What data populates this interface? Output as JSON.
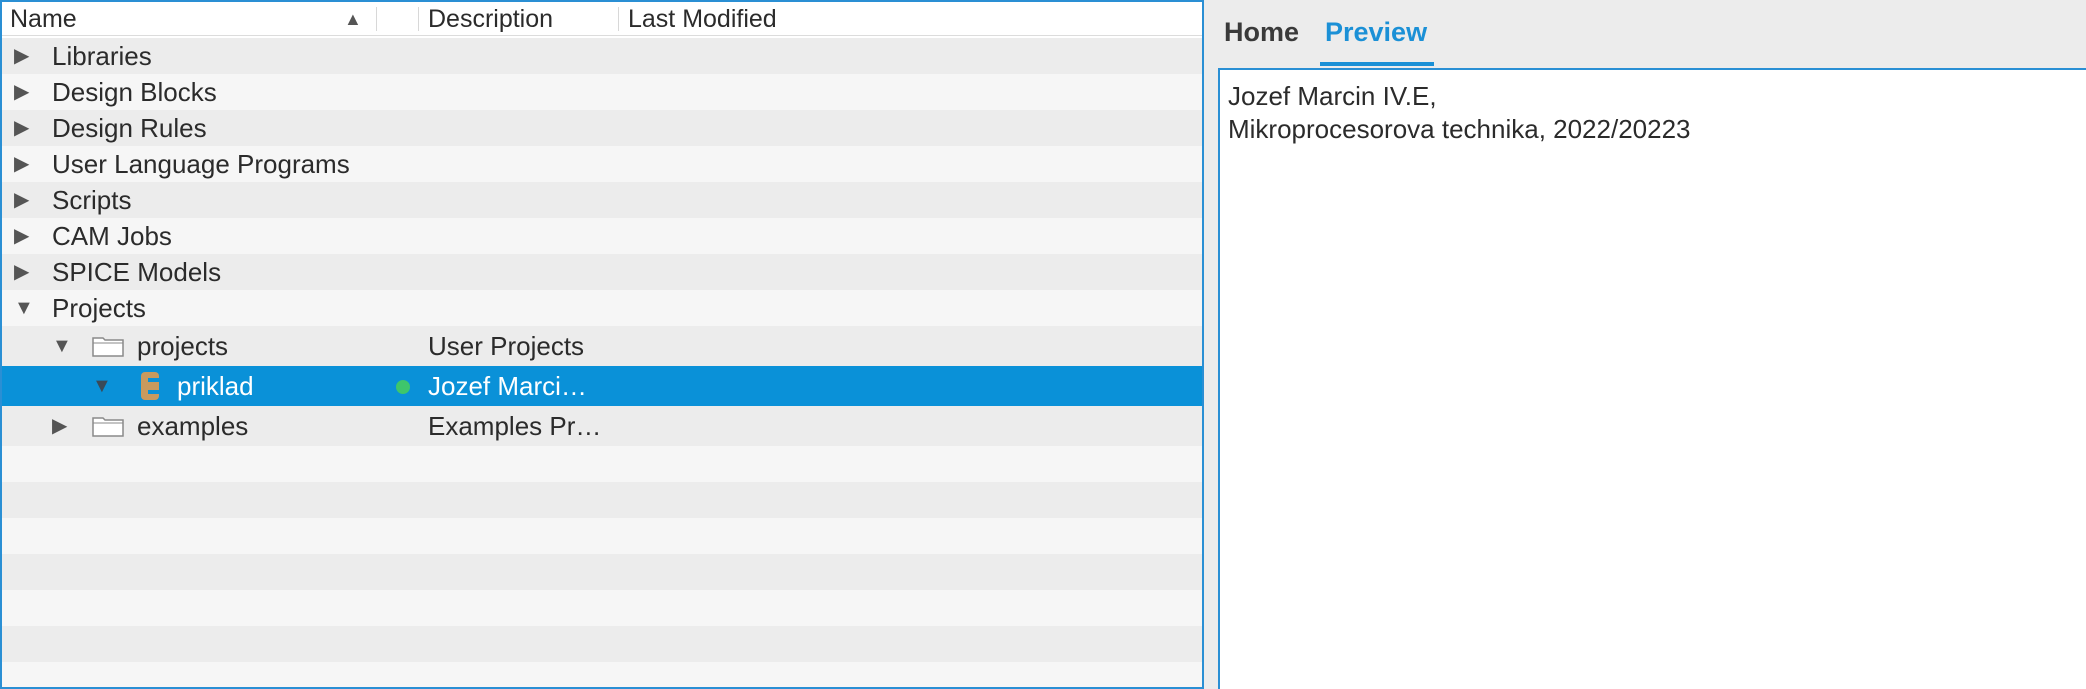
{
  "tree": {
    "columns": {
      "name": "Name",
      "description": "Description",
      "last_modified": "Last Modified"
    },
    "sort_indicator": "▲",
    "rows": [
      {
        "label": "Libraries",
        "expanded": false
      },
      {
        "label": "Design Blocks",
        "expanded": false
      },
      {
        "label": "Design Rules",
        "expanded": false
      },
      {
        "label": "User Language Programs",
        "expanded": false
      },
      {
        "label": "Scripts",
        "expanded": false
      },
      {
        "label": "CAM Jobs",
        "expanded": false
      },
      {
        "label": "SPICE Models",
        "expanded": false
      },
      {
        "label": "Projects",
        "expanded": true
      }
    ],
    "projects_folder": {
      "label": "projects",
      "description": "User Projects"
    },
    "selected_project": {
      "label": "priklad",
      "description": "Jozef Marci…"
    },
    "examples_folder": {
      "label": "examples",
      "description": "Examples Pr…"
    },
    "expanded_glyph": "▼",
    "collapsed_glyph": "▶"
  },
  "tabs": {
    "home": "Home",
    "preview": "Preview",
    "active": "Preview"
  },
  "preview": {
    "line1": "Jozef Marcin IV.E,",
    "line2": "Mikroprocesorova technika, 2022/20223"
  },
  "colors": {
    "selection": "#0a91d8",
    "accent": "#1b90d6",
    "status_dot": "#3ec66b",
    "e_icon": "#c99a5e"
  },
  "icons": {
    "folder": "folder-icon",
    "project": "eagle-project-icon",
    "status": "status-dot-icon"
  }
}
